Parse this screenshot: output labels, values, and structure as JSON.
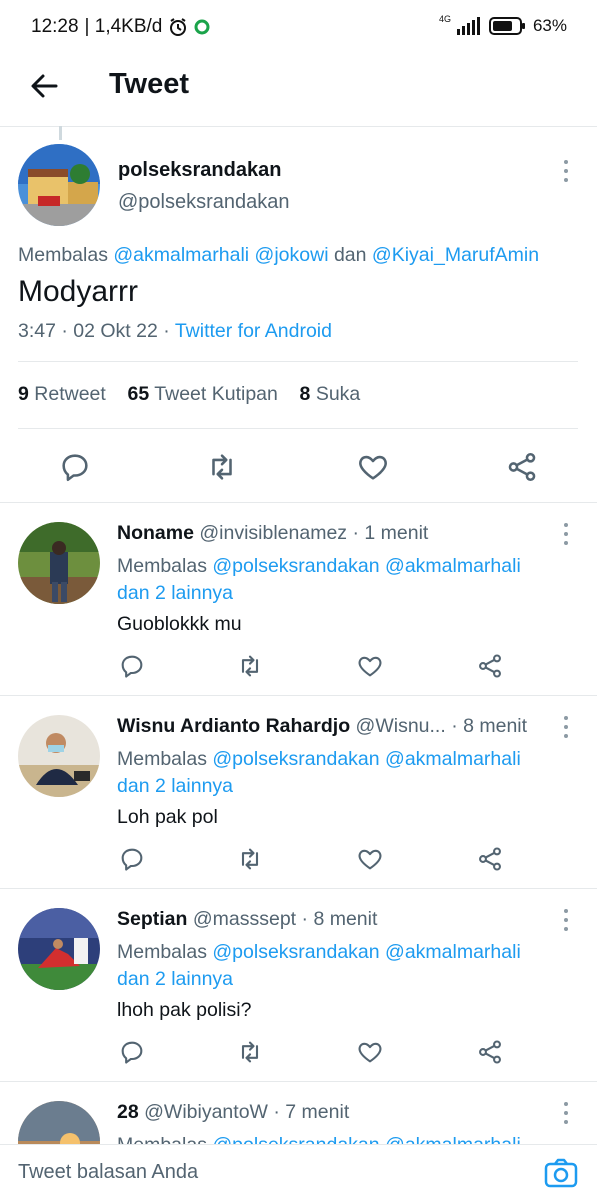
{
  "status_bar": {
    "time": "12:28",
    "speed": "| 1,4KB/d",
    "network": "4G",
    "battery": "63%"
  },
  "app_bar": {
    "title": "Tweet"
  },
  "tweet": {
    "name": "polseksrandakan",
    "handle": "@polseksrandakan",
    "reply_prefix": "Membalas",
    "reply_user1": "@akmalmarhali",
    "reply_user2": "@jokowi",
    "reply_and": "dan",
    "reply_user3": "@Kiyai_MarufAmin",
    "text": "Modyarrr",
    "time": "3:47 · 02 Okt 22 ·",
    "client": "Twitter for Android",
    "stats": {
      "retweets_count": "9",
      "retweets_label": "Retweet",
      "quotes_count": "65",
      "quotes_label": "Tweet Kutipan",
      "likes_count": "8",
      "likes_label": "Suka"
    }
  },
  "replies": [
    {
      "name": "Noname",
      "handle": "@invisiblenamez",
      "time": "· 1 menit",
      "reply_prefix": "Membalas",
      "mention1": "@polseksrandakan",
      "mention2": "@akmalmarhali",
      "others": "dan 2 lainnya",
      "text": "Guoblokkk mu"
    },
    {
      "name": "Wisnu Ardianto Rahardjo",
      "handle": "@Wisnu...",
      "time": "· 8 menit",
      "reply_prefix": "Membalas",
      "mention1": "@polseksrandakan",
      "mention2": "@akmalmarhali",
      "others": "dan 2 lainnya",
      "text": "Loh pak pol"
    },
    {
      "name": "Septian",
      "handle": "@masssept",
      "time": "· 8 menit",
      "reply_prefix": "Membalas",
      "mention1": "@polseksrandakan",
      "mention2": "@akmalmarhali",
      "others": "dan 2 lainnya",
      "text": "lhoh pak polisi?"
    },
    {
      "name": "28",
      "handle": "@WibiyantoW",
      "time": "· 7 menit",
      "reply_prefix": "Membalas",
      "mention1": "@polseksrandakan",
      "mention2": "@akmalmarhali",
      "others": "",
      "text": ""
    }
  ],
  "composer": {
    "placeholder": "Tweet balasan Anda"
  },
  "colors": {
    "link": "#1d9bf0",
    "secondary_text": "#536471",
    "divider": "#e6e9eb"
  },
  "icons": [
    "back-arrow-icon",
    "reply-icon",
    "retweet-icon",
    "like-icon",
    "share-icon",
    "more-vertical-icon",
    "camera-icon",
    "alarm-icon",
    "signal-icon",
    "battery-icon"
  ]
}
